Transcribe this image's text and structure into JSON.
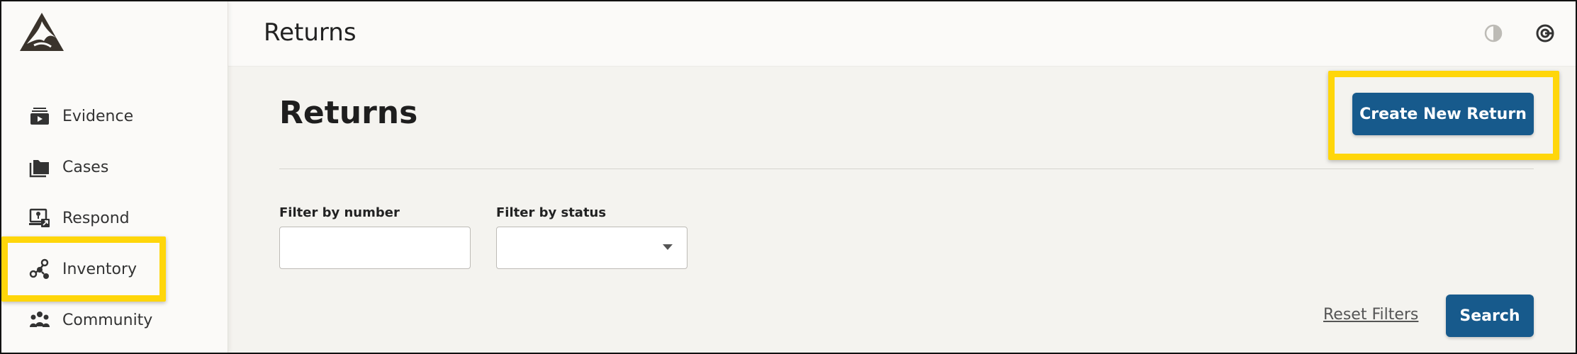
{
  "sidebar": {
    "items": [
      {
        "label": "Evidence"
      },
      {
        "label": "Cases"
      },
      {
        "label": "Respond"
      },
      {
        "label": "Inventory"
      },
      {
        "label": "Community"
      }
    ]
  },
  "header": {
    "title": "Returns",
    "icons": [
      "contrast-icon",
      "account-icon"
    ]
  },
  "main": {
    "title": "Returns",
    "create_button": "Create New Return",
    "filters": {
      "number": {
        "label": "Filter by number",
        "value": ""
      },
      "status": {
        "label": "Filter by status",
        "value": ""
      }
    },
    "reset_link": "Reset Filters",
    "search_button": "Search"
  },
  "colors": {
    "accent": "#175a8c",
    "highlight": "#ffd60a"
  }
}
